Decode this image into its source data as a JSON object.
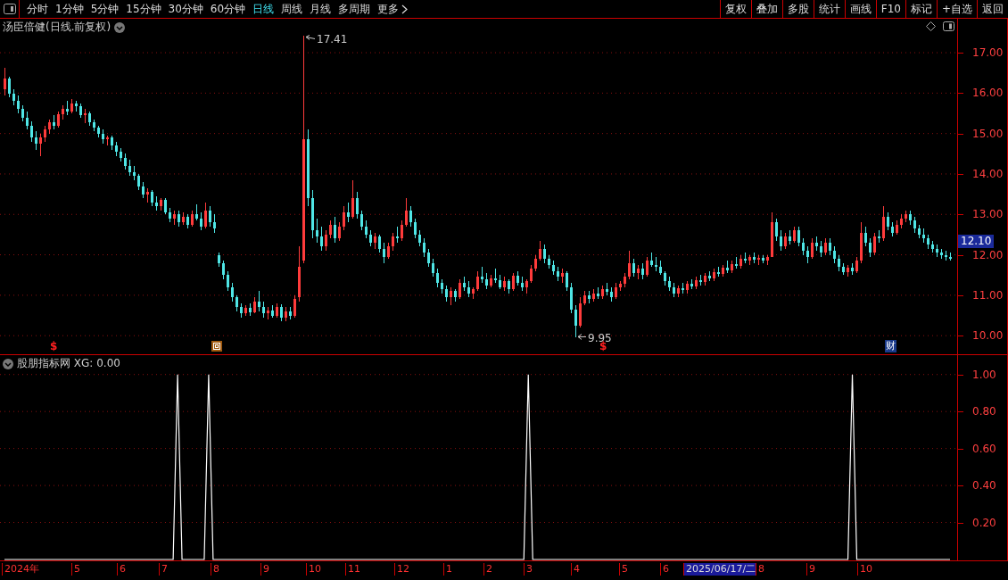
{
  "toolbar": {
    "periods": [
      {
        "label": "分时",
        "selected": false
      },
      {
        "label": "1分钟",
        "selected": false
      },
      {
        "label": "5分钟",
        "selected": false
      },
      {
        "label": "15分钟",
        "selected": false
      },
      {
        "label": "30分钟",
        "selected": false
      },
      {
        "label": "60分钟",
        "selected": false
      },
      {
        "label": "日线",
        "selected": true
      },
      {
        "label": "周线",
        "selected": false
      },
      {
        "label": "月线",
        "selected": false
      },
      {
        "label": "多周期",
        "selected": false
      },
      {
        "label": "更多",
        "selected": false
      }
    ],
    "actions": [
      "复权",
      "叠加",
      "多股",
      "统计",
      "画线",
      "F10",
      "标记",
      "+自选",
      "返回"
    ]
  },
  "main_panel": {
    "title": "汤臣倍健(日线.前复权)",
    "high_label": "17.41",
    "low_label": "9.95",
    "current_price": "12.10",
    "markers": [
      {
        "kind": "dividend",
        "text": "$"
      },
      {
        "kind": "event"
      },
      {
        "kind": "dividend",
        "text": "$"
      },
      {
        "kind": "finance",
        "text": "财"
      }
    ],
    "chart_data": {
      "type": "candlestick",
      "ylim": [
        9.54,
        17.84
      ],
      "grid": true,
      "yticks": [
        {
          "value": 17,
          "label": "17.00"
        },
        {
          "value": 16,
          "label": "16.00"
        },
        {
          "value": 15,
          "label": "15.00"
        },
        {
          "value": 14,
          "label": "14.00"
        },
        {
          "value": 13,
          "label": "13.00"
        },
        {
          "value": 12,
          "label": "12.00"
        },
        {
          "value": 11,
          "label": "11.00"
        },
        {
          "value": 10,
          "label": "10.00"
        }
      ],
      "categories": [
        null,
        null,
        null,
        null,
        null,
        null,
        null,
        null,
        null,
        null,
        null,
        null,
        null,
        null,
        null,
        null,
        null,
        null,
        null,
        null,
        null,
        null,
        null,
        null,
        null,
        null,
        null,
        null,
        null,
        null,
        null,
        null,
        null,
        null,
        null,
        null,
        null,
        null,
        null,
        null,
        null,
        null,
        null,
        null,
        null,
        null,
        null,
        null,
        null,
        null,
        null,
        null,
        null,
        null,
        null,
        null,
        null,
        null,
        null,
        null,
        null,
        null,
        null,
        null,
        null,
        null,
        null,
        null,
        null,
        null,
        null,
        null,
        null,
        null,
        null,
        null,
        null,
        null,
        null,
        null,
        null,
        null,
        null,
        null,
        null,
        null,
        null,
        null,
        null,
        null,
        null,
        null,
        null,
        null,
        null,
        null,
        null,
        null,
        null,
        null,
        null,
        null,
        null,
        null,
        null,
        null,
        null,
        null,
        null,
        null,
        null,
        null,
        null,
        null,
        null,
        null,
        null,
        null,
        null,
        null,
        null,
        null,
        null,
        null,
        null,
        null,
        null,
        null,
        null,
        null,
        null,
        null,
        null,
        null,
        null,
        null,
        null,
        null,
        null,
        null,
        null,
        null,
        null,
        null,
        null,
        null,
        null,
        null,
        null,
        null,
        null,
        null,
        null,
        null,
        null,
        null,
        null,
        null,
        null,
        null,
        null,
        null,
        null,
        null,
        null,
        null,
        null,
        null,
        null,
        null,
        null,
        null,
        null,
        null,
        null,
        null,
        null,
        null,
        null,
        null,
        null,
        null,
        null,
        null,
        null,
        null,
        null,
        null,
        null,
        null,
        null,
        null,
        null,
        null,
        null,
        null,
        null,
        null,
        null,
        null,
        null,
        null,
        null,
        null,
        null,
        null,
        null,
        null,
        null,
        null,
        null,
        null,
        null
      ],
      "ohlc": [
        [
          16.1,
          16.62,
          15.95,
          16.35
        ],
        [
          16.35,
          16.4,
          15.9,
          15.98
        ],
        [
          15.98,
          16.1,
          15.7,
          15.8
        ],
        [
          15.8,
          15.95,
          15.5,
          15.62
        ],
        [
          15.62,
          15.7,
          15.3,
          15.4
        ],
        [
          15.4,
          15.55,
          15.1,
          15.2
        ],
        [
          15.2,
          15.3,
          14.8,
          14.9
        ],
        [
          14.9,
          15.05,
          14.6,
          14.75
        ],
        [
          14.75,
          15.0,
          14.45,
          14.9
        ],
        [
          14.9,
          15.2,
          14.8,
          15.1
        ],
        [
          15.1,
          15.35,
          15.0,
          15.28
        ],
        [
          15.28,
          15.45,
          15.1,
          15.2
        ],
        [
          15.2,
          15.55,
          15.15,
          15.48
        ],
        [
          15.48,
          15.7,
          15.35,
          15.6
        ],
        [
          15.6,
          15.8,
          15.45,
          15.55
        ],
        [
          15.55,
          15.85,
          15.5,
          15.75
        ],
        [
          15.75,
          15.82,
          15.55,
          15.68
        ],
        [
          15.68,
          15.75,
          15.4,
          15.45
        ],
        [
          15.45,
          15.6,
          15.25,
          15.5
        ],
        [
          15.5,
          15.55,
          15.2,
          15.28
        ],
        [
          15.28,
          15.35,
          15.05,
          15.15
        ],
        [
          15.15,
          15.2,
          14.9,
          15.0
        ],
        [
          15.0,
          15.1,
          14.75,
          14.85
        ],
        [
          14.85,
          14.95,
          14.7,
          14.9
        ],
        [
          14.9,
          14.95,
          14.6,
          14.7
        ],
        [
          14.7,
          14.8,
          14.45,
          14.55
        ],
        [
          14.55,
          14.65,
          14.3,
          14.4
        ],
        [
          14.4,
          14.5,
          14.1,
          14.2
        ],
        [
          14.2,
          14.35,
          13.95,
          14.05
        ],
        [
          14.05,
          14.2,
          13.85,
          13.95
        ],
        [
          13.95,
          14.0,
          13.6,
          13.7
        ],
        [
          13.7,
          13.8,
          13.4,
          13.5
        ],
        [
          13.5,
          13.65,
          13.3,
          13.55
        ],
        [
          13.55,
          13.6,
          13.2,
          13.3
        ],
        [
          13.3,
          13.45,
          13.1,
          13.2
        ],
        [
          13.2,
          13.4,
          13.1,
          13.35
        ],
        [
          13.35,
          13.4,
          13.0,
          13.05
        ],
        [
          13.05,
          13.15,
          12.8,
          12.9
        ],
        [
          12.9,
          13.1,
          12.75,
          13.0
        ],
        [
          13.0,
          13.1,
          12.7,
          12.8
        ],
        [
          12.8,
          13.05,
          12.75,
          12.95
        ],
        [
          12.95,
          13.0,
          12.65,
          12.75
        ],
        [
          12.75,
          13.1,
          12.7,
          13.0
        ],
        [
          13.0,
          13.25,
          12.85,
          12.9
        ],
        [
          12.9,
          13.05,
          12.6,
          12.7
        ],
        [
          12.7,
          13.3,
          12.65,
          13.1
        ],
        [
          13.1,
          13.2,
          12.7,
          12.8
        ],
        [
          12.8,
          13.0,
          12.55,
          12.65
        ],
        [
          12.0,
          12.05,
          11.7,
          11.8
        ],
        [
          11.8,
          11.85,
          11.4,
          11.5
        ],
        [
          11.5,
          11.6,
          11.1,
          11.2
        ],
        [
          11.2,
          11.3,
          10.85,
          10.95
        ],
        [
          10.95,
          11.0,
          10.6,
          10.7
        ],
        [
          10.7,
          10.8,
          10.45,
          10.55
        ],
        [
          10.55,
          10.75,
          10.5,
          10.68
        ],
        [
          10.68,
          10.8,
          10.5,
          10.58
        ],
        [
          10.58,
          10.95,
          10.55,
          10.85
        ],
        [
          10.85,
          11.1,
          10.6,
          10.7
        ],
        [
          10.7,
          10.85,
          10.45,
          10.55
        ],
        [
          10.55,
          10.7,
          10.4,
          10.62
        ],
        [
          10.62,
          10.75,
          10.45,
          10.5
        ],
        [
          10.5,
          10.8,
          10.45,
          10.72
        ],
        [
          10.72,
          10.78,
          10.35,
          10.45
        ],
        [
          10.45,
          10.7,
          10.35,
          10.6
        ],
        [
          10.6,
          10.7,
          10.4,
          10.5
        ],
        [
          10.5,
          11.0,
          10.45,
          10.9
        ],
        [
          10.95,
          12.2,
          10.85,
          11.7
        ],
        [
          11.85,
          17.41,
          11.8,
          14.85
        ],
        [
          14.85,
          15.1,
          13.2,
          13.4
        ],
        [
          13.4,
          13.6,
          12.4,
          12.6
        ],
        [
          12.6,
          12.9,
          12.3,
          12.45
        ],
        [
          12.45,
          12.7,
          12.1,
          12.2
        ],
        [
          12.2,
          12.6,
          12.1,
          12.5
        ],
        [
          12.5,
          12.85,
          12.4,
          12.75
        ],
        [
          12.75,
          12.95,
          12.3,
          12.4
        ],
        [
          12.4,
          12.8,
          12.35,
          12.7
        ],
        [
          12.7,
          13.2,
          12.6,
          13.05
        ],
        [
          13.05,
          13.3,
          12.8,
          12.95
        ],
        [
          12.95,
          13.85,
          12.9,
          13.4
        ],
        [
          13.4,
          13.55,
          12.9,
          13.0
        ],
        [
          13.0,
          13.1,
          12.6,
          12.7
        ],
        [
          12.7,
          12.85,
          12.4,
          12.5
        ],
        [
          12.5,
          12.6,
          12.2,
          12.3
        ],
        [
          12.3,
          12.55,
          12.15,
          12.45
        ],
        [
          12.45,
          12.5,
          12.05,
          12.15
        ],
        [
          12.15,
          12.3,
          11.8,
          11.95
        ],
        [
          11.95,
          12.3,
          11.9,
          12.2
        ],
        [
          12.2,
          12.55,
          12.1,
          12.45
        ],
        [
          12.45,
          12.7,
          12.3,
          12.4
        ],
        [
          12.4,
          12.85,
          12.35,
          12.75
        ],
        [
          12.75,
          13.4,
          12.7,
          13.1
        ],
        [
          13.1,
          13.2,
          12.7,
          12.8
        ],
        [
          12.8,
          12.9,
          12.4,
          12.5
        ],
        [
          12.5,
          12.6,
          12.2,
          12.3
        ],
        [
          12.3,
          12.4,
          11.95,
          12.05
        ],
        [
          12.05,
          12.15,
          11.7,
          11.8
        ],
        [
          11.8,
          11.9,
          11.45,
          11.55
        ],
        [
          11.55,
          11.65,
          11.2,
          11.3
        ],
        [
          11.3,
          11.4,
          11.05,
          11.15
        ],
        [
          11.15,
          11.25,
          10.85,
          10.95
        ],
        [
          10.95,
          11.2,
          10.75,
          11.1
        ],
        [
          11.1,
          11.15,
          10.85,
          10.95
        ],
        [
          10.95,
          11.4,
          10.9,
          11.3
        ],
        [
          11.3,
          11.45,
          11.1,
          11.2
        ],
        [
          11.2,
          11.35,
          10.95,
          11.05
        ],
        [
          11.05,
          11.2,
          10.9,
          11.15
        ],
        [
          11.15,
          11.6,
          11.1,
          11.45
        ],
        [
          11.45,
          11.7,
          11.3,
          11.4
        ],
        [
          11.4,
          11.55,
          11.15,
          11.25
        ],
        [
          11.25,
          11.5,
          11.2,
          11.42
        ],
        [
          11.42,
          11.65,
          11.3,
          11.38
        ],
        [
          11.38,
          11.5,
          11.15,
          11.2
        ],
        [
          11.2,
          11.45,
          11.1,
          11.35
        ],
        [
          11.35,
          11.4,
          11.05,
          11.15
        ],
        [
          11.15,
          11.55,
          11.1,
          11.48
        ],
        [
          11.48,
          11.6,
          11.25,
          11.3
        ],
        [
          11.3,
          11.45,
          11.1,
          11.2
        ],
        [
          11.2,
          11.4,
          11.05,
          11.35
        ],
        [
          11.35,
          11.75,
          11.3,
          11.65
        ],
        [
          11.65,
          12.0,
          11.6,
          11.9
        ],
        [
          11.9,
          12.35,
          11.85,
          12.15
        ],
        [
          12.15,
          12.25,
          11.8,
          11.9
        ],
        [
          11.9,
          12.0,
          11.65,
          11.75
        ],
        [
          11.75,
          11.85,
          11.5,
          11.6
        ],
        [
          11.6,
          11.7,
          11.35,
          11.45
        ],
        [
          11.45,
          11.65,
          11.3,
          11.55
        ],
        [
          11.55,
          11.6,
          11.1,
          11.2
        ],
        [
          11.2,
          11.3,
          10.55,
          10.65
        ],
        [
          10.65,
          10.75,
          9.95,
          10.25
        ],
        [
          10.25,
          10.95,
          10.2,
          10.8
        ],
        [
          10.8,
          11.1,
          10.75,
          11.0
        ],
        [
          11.0,
          11.1,
          10.8,
          10.9
        ],
        [
          10.9,
          11.15,
          10.85,
          11.05
        ],
        [
          11.05,
          11.2,
          10.9,
          10.98
        ],
        [
          10.98,
          11.25,
          10.9,
          11.15
        ],
        [
          11.15,
          11.3,
          11.0,
          11.08
        ],
        [
          11.08,
          11.2,
          10.85,
          10.95
        ],
        [
          10.95,
          11.3,
          10.9,
          11.2
        ],
        [
          11.2,
          11.35,
          11.1,
          11.28
        ],
        [
          11.28,
          11.55,
          11.2,
          11.45
        ],
        [
          11.45,
          12.1,
          11.4,
          11.8
        ],
        [
          11.8,
          11.9,
          11.45,
          11.55
        ],
        [
          11.55,
          11.75,
          11.4,
          11.65
        ],
        [
          11.65,
          11.8,
          11.4,
          11.5
        ],
        [
          11.5,
          11.95,
          11.45,
          11.85
        ],
        [
          11.85,
          12.05,
          11.7,
          11.75
        ],
        [
          11.75,
          11.95,
          11.6,
          11.7
        ],
        [
          11.7,
          11.85,
          11.5,
          11.55
        ],
        [
          11.55,
          11.6,
          11.25,
          11.35
        ],
        [
          11.35,
          11.45,
          11.1,
          11.2
        ],
        [
          11.2,
          11.3,
          10.95,
          11.05
        ],
        [
          11.05,
          11.25,
          10.95,
          11.18
        ],
        [
          11.18,
          11.3,
          11.05,
          11.12
        ],
        [
          11.12,
          11.35,
          11.05,
          11.28
        ],
        [
          11.28,
          11.4,
          11.15,
          11.22
        ],
        [
          11.22,
          11.45,
          11.15,
          11.38
        ],
        [
          11.38,
          11.5,
          11.25,
          11.32
        ],
        [
          11.32,
          11.55,
          11.25,
          11.48
        ],
        [
          11.48,
          11.6,
          11.35,
          11.42
        ],
        [
          11.42,
          11.65,
          11.35,
          11.58
        ],
        [
          11.58,
          11.7,
          11.45,
          11.52
        ],
        [
          11.52,
          11.75,
          11.45,
          11.68
        ],
        [
          11.68,
          11.85,
          11.55,
          11.62
        ],
        [
          11.62,
          11.85,
          11.55,
          11.78
        ],
        [
          11.78,
          11.95,
          11.65,
          11.72
        ],
        [
          11.72,
          12.0,
          11.65,
          11.9
        ],
        [
          11.9,
          12.05,
          11.8,
          11.85
        ],
        [
          11.85,
          12.0,
          11.75,
          11.95
        ],
        [
          11.95,
          12.05,
          11.8,
          11.88
        ],
        [
          11.88,
          12.0,
          11.75,
          11.92
        ],
        [
          11.92,
          12.0,
          11.8,
          11.85
        ],
        [
          11.85,
          12.0,
          11.75,
          11.95
        ],
        [
          11.95,
          13.05,
          11.95,
          12.8
        ],
        [
          12.8,
          12.9,
          12.35,
          12.45
        ],
        [
          12.45,
          12.6,
          12.1,
          12.2
        ],
        [
          12.2,
          12.55,
          12.15,
          12.45
        ],
        [
          12.45,
          12.6,
          12.25,
          12.35
        ],
        [
          12.35,
          12.7,
          12.3,
          12.6
        ],
        [
          12.6,
          12.7,
          12.2,
          12.3
        ],
        [
          12.3,
          12.4,
          12.0,
          12.1
        ],
        [
          12.1,
          12.2,
          11.8,
          11.95
        ],
        [
          11.95,
          12.4,
          11.9,
          12.3
        ],
        [
          12.3,
          12.45,
          12.1,
          12.2
        ],
        [
          12.2,
          12.35,
          11.95,
          12.05
        ],
        [
          12.05,
          12.4,
          12.0,
          12.3
        ],
        [
          12.3,
          12.4,
          12.0,
          12.1
        ],
        [
          12.1,
          12.2,
          11.8,
          11.9
        ],
        [
          11.9,
          12.0,
          11.6,
          11.7
        ],
        [
          11.7,
          11.8,
          11.5,
          11.58
        ],
        [
          11.58,
          11.75,
          11.45,
          11.68
        ],
        [
          11.68,
          11.8,
          11.5,
          11.6
        ],
        [
          11.6,
          11.95,
          11.55,
          11.85
        ],
        [
          11.85,
          12.8,
          11.8,
          12.55
        ],
        [
          12.55,
          12.7,
          12.2,
          12.3
        ],
        [
          12.3,
          12.4,
          11.95,
          12.05
        ],
        [
          12.05,
          12.55,
          12.0,
          12.45
        ],
        [
          12.45,
          12.6,
          12.3,
          12.4
        ],
        [
          12.4,
          13.2,
          12.35,
          12.95
        ],
        [
          12.95,
          13.05,
          12.6,
          12.7
        ],
        [
          12.7,
          12.8,
          12.45,
          12.55
        ],
        [
          12.55,
          12.85,
          12.5,
          12.75
        ],
        [
          12.75,
          13.0,
          12.65,
          12.9
        ],
        [
          12.9,
          13.1,
          12.8,
          13.0
        ],
        [
          13.0,
          13.1,
          12.75,
          12.85
        ],
        [
          12.85,
          12.95,
          12.55,
          12.65
        ],
        [
          12.65,
          12.75,
          12.4,
          12.5
        ],
        [
          12.5,
          12.65,
          12.3,
          12.4
        ],
        [
          12.4,
          12.5,
          12.15,
          12.25
        ],
        [
          12.25,
          12.35,
          12.05,
          12.15
        ],
        [
          12.15,
          12.25,
          11.95,
          12.05
        ],
        [
          12.05,
          12.15,
          11.9,
          12.0
        ],
        [
          12.0,
          12.1,
          11.85,
          11.95
        ],
        [
          11.95,
          12.05,
          11.85,
          11.9
        ]
      ]
    }
  },
  "indicator_panel": {
    "title": "股朋指标网 XG: 0.00",
    "chart_data": {
      "type": "line",
      "categories": [
        null,
        null,
        null,
        null,
        null,
        null,
        null,
        null,
        null,
        null,
        null,
        null,
        null,
        null,
        null,
        null,
        null,
        null,
        null,
        null,
        null,
        null,
        null,
        null,
        null,
        null,
        null,
        null,
        null,
        null,
        null,
        null,
        null,
        null,
        null,
        null,
        null,
        null,
        null,
        null,
        null,
        null,
        null,
        null,
        null,
        null,
        null,
        null,
        null,
        null,
        null,
        null,
        null,
        null,
        null,
        null,
        null,
        null,
        null,
        null,
        null,
        null,
        null,
        null,
        null,
        null,
        null,
        null,
        null,
        null,
        null,
        null,
        null,
        null,
        null,
        null,
        null,
        null,
        null,
        null,
        null,
        null,
        null,
        null,
        null,
        null,
        null,
        null,
        null,
        null,
        null,
        null,
        null,
        null,
        null,
        null,
        null,
        null,
        null,
        null,
        null,
        null,
        null,
        null,
        null,
        null,
        null,
        null,
        null,
        null,
        null,
        null,
        null,
        null,
        null,
        null,
        null,
        null,
        null,
        null,
        null,
        null,
        null,
        null,
        null,
        null,
        null,
        null,
        null,
        null,
        null,
        null,
        null,
        null,
        null,
        null,
        null,
        null,
        null,
        null,
        null,
        null,
        null,
        null,
        null,
        null,
        null,
        null,
        null,
        null,
        null,
        null,
        null,
        null,
        null,
        null,
        null,
        null,
        null,
        null,
        null,
        null,
        null,
        null,
        null,
        null,
        null,
        null,
        null,
        null,
        null,
        null,
        null,
        null,
        null,
        null,
        null,
        null,
        null,
        null,
        null,
        null,
        null,
        null,
        null,
        null,
        null,
        null,
        null,
        null,
        null,
        null,
        null,
        null,
        null,
        null,
        null,
        null,
        null,
        null,
        null,
        null,
        null,
        null,
        null,
        null,
        null,
        null,
        null,
        null,
        null,
        null,
        null,
        null
      ],
      "series": [
        {
          "color": "#ffffff",
          "values": [
            0,
            0,
            0,
            0,
            0,
            0,
            0,
            0,
            0,
            0,
            0,
            0,
            0,
            0,
            0,
            0,
            0,
            0,
            0,
            0,
            0,
            0,
            0,
            0,
            0,
            0,
            0,
            0,
            0,
            0,
            0,
            0,
            0,
            0,
            0,
            0,
            0,
            0,
            0,
            1,
            0,
            0,
            0,
            0,
            0,
            0,
            1,
            0,
            0,
            0,
            0,
            0,
            0,
            0,
            0,
            0,
            0,
            0,
            0,
            0,
            0,
            0,
            0,
            0,
            0,
            0,
            0,
            0,
            0,
            0,
            0,
            0,
            0,
            0,
            0,
            0,
            0,
            0,
            0,
            0,
            0,
            0,
            0,
            0,
            0,
            0,
            0,
            0,
            0,
            0,
            0,
            0,
            0,
            0,
            0,
            0,
            0,
            0,
            0,
            0,
            0,
            0,
            0,
            0,
            0,
            0,
            0,
            0,
            0,
            0,
            0,
            0,
            0,
            0,
            0,
            0,
            0,
            0,
            1,
            0,
            0,
            0,
            0,
            0,
            0,
            0,
            0,
            0,
            0,
            0,
            0,
            0,
            0,
            0,
            0,
            0,
            0,
            0,
            0,
            0,
            0,
            0,
            0,
            0,
            0,
            0,
            0,
            0,
            0,
            0,
            0,
            0,
            0,
            0,
            0,
            0,
            0,
            0,
            0,
            0,
            0,
            0,
            0,
            0,
            0,
            0,
            0,
            0,
            0,
            0,
            0,
            0,
            0,
            0,
            0,
            0,
            0,
            0,
            0,
            0,
            0,
            0,
            0,
            0,
            0,
            0,
            0,
            0,
            0,
            0,
            0,
            1,
            0,
            0,
            0,
            0,
            0,
            0,
            0,
            0,
            0,
            0,
            0,
            0,
            0,
            0,
            0,
            0,
            0,
            0,
            0,
            0,
            0,
            0
          ]
        }
      ],
      "ylim": [
        0,
        1.1
      ],
      "grid": true,
      "yticks": [
        {
          "value": 1,
          "label": "1.00"
        },
        {
          "value": 0.8,
          "label": "0.80"
        },
        {
          "value": 0.6,
          "label": "0.60"
        },
        {
          "value": 0.4,
          "label": "0.40"
        },
        {
          "value": 0.2,
          "label": "0.20"
        }
      ]
    }
  },
  "time_axis": [
    {
      "label": "2024年",
      "selected": false
    },
    {
      "label": "5",
      "selected": false
    },
    {
      "label": "6",
      "selected": false
    },
    {
      "label": "7",
      "selected": false
    },
    {
      "label": "8",
      "selected": false
    },
    {
      "label": "9",
      "selected": false
    },
    {
      "label": "10",
      "selected": false
    },
    {
      "label": "11",
      "selected": false
    },
    {
      "label": "12",
      "selected": false
    },
    {
      "label": "1",
      "selected": false
    },
    {
      "label": "2",
      "selected": false
    },
    {
      "label": "3",
      "selected": false
    },
    {
      "label": "4",
      "selected": false
    },
    {
      "label": "5",
      "selected": false
    },
    {
      "label": "6",
      "selected": false
    },
    {
      "label": "2025/06/17/二",
      "selected": true
    },
    {
      "label": "8",
      "selected": false
    },
    {
      "label": "9",
      "selected": false
    },
    {
      "label": "10",
      "selected": false
    }
  ]
}
